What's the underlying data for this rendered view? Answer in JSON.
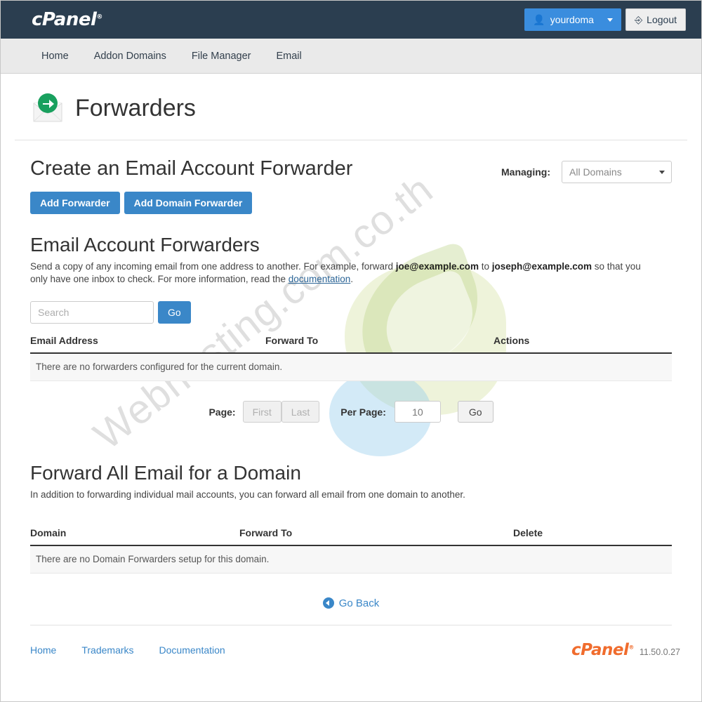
{
  "header": {
    "logo_text": "cPanel",
    "user_button_label": "yourdoma",
    "logout_label": "Logout",
    "user_icon": "person-icon",
    "logout_icon": "logout-icon",
    "caret_icon": "chevron-down-icon",
    "bg_color": "#2b3e50",
    "accent_color": "#3a8dde"
  },
  "nav": {
    "items": [
      {
        "label": "Home"
      },
      {
        "label": "Addon Domains"
      },
      {
        "label": "File Manager"
      },
      {
        "label": "Email"
      }
    ]
  },
  "page": {
    "title": "Forwarders",
    "icon": "forwarders-envelope-arrow-icon"
  },
  "create_section": {
    "heading": "Create an Email Account Forwarder",
    "managing_label": "Managing:",
    "managing_selected": "All Domains",
    "managing_options": [
      "All Domains"
    ],
    "buttons": [
      {
        "label": "Add Forwarder"
      },
      {
        "label": "Add Domain Forwarder"
      }
    ]
  },
  "account_forwarders": {
    "heading": "Email Account Forwarders",
    "description_part1": "Send a copy of any incoming email from one address to another. For example, forward ",
    "email_from": "joe@example.com",
    "description_to": " to ",
    "email_to": "joseph@example.com",
    "description_part2": " so that you only have one inbox to check. For more information, read the ",
    "doc_link_label": "documentation",
    "description_end": ".",
    "search_placeholder": "Search",
    "search_value": "",
    "search_go_label": "Go",
    "columns": [
      "Email Address",
      "Forward To",
      "Actions"
    ],
    "empty_message": "There are no forwarders configured for the current domain."
  },
  "pagination": {
    "page_label": "Page:",
    "first_label": "First",
    "last_label": "Last",
    "per_page_label": "Per Page:",
    "per_page_value": "10",
    "go_label": "Go"
  },
  "domain_forwarders": {
    "heading": "Forward All Email for a Domain",
    "description": "In addition to forwarding individual mail accounts, you can forward all email from one domain to another.",
    "columns": [
      "Domain",
      "Forward To",
      "Delete"
    ],
    "empty_message": "There are no Domain Forwarders setup for this domain."
  },
  "go_back": {
    "label": "Go Back",
    "icon": "arrow-left-circle-icon"
  },
  "footer": {
    "links": [
      {
        "label": "Home"
      },
      {
        "label": "Trademarks"
      },
      {
        "label": "Documentation"
      }
    ],
    "logo_text": "cPanel",
    "version": "11.50.0.27",
    "logo_color": "#f06c2d"
  },
  "watermark": {
    "text": "Webhosting.com.co.th"
  }
}
